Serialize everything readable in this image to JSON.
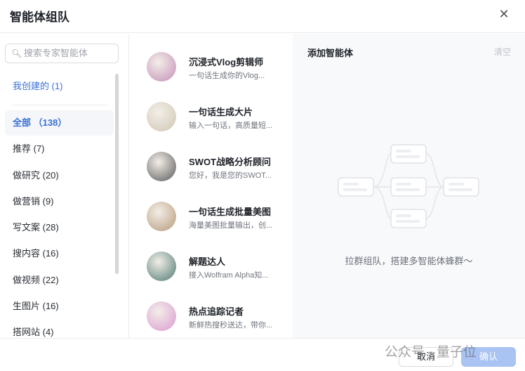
{
  "header": {
    "title": "智能体组队"
  },
  "sidebar": {
    "search_placeholder": "搜索专家智能体",
    "my_created": "我创建的 (1)",
    "categories": [
      {
        "label": "全部 （138）"
      },
      {
        "label": "推荐 (7)"
      },
      {
        "label": "做研究 (20)"
      },
      {
        "label": "做营销 (9)"
      },
      {
        "label": "写文案 (28)"
      },
      {
        "label": "搜内容 (16)"
      },
      {
        "label": "做视频 (22)"
      },
      {
        "label": "生图片 (16)"
      },
      {
        "label": "搭网站 (4)"
      }
    ]
  },
  "agents": [
    {
      "name": "沉浸式Vlog剪辑师",
      "desc": "一句话生成你的Vlog...",
      "color": "#c58fb8"
    },
    {
      "name": "一句话生成大片",
      "desc": "输入一句话，高质量短...",
      "color": "#cfc6b3"
    },
    {
      "name": "SWOT战略分析顾问",
      "desc": "您好，我是您的SWOT...",
      "color": "#5a5a5a"
    },
    {
      "name": "一句话生成批量美图",
      "desc": "海量美图批量输出，创...",
      "color": "#b79a7a"
    },
    {
      "name": "解题达人",
      "desc": "接入Wolfram Alpha知...",
      "color": "#4d7a72"
    },
    {
      "name": "热点追踪记者",
      "desc": "新鲜热搜秒送达，带你...",
      "color": "#d99ad0"
    }
  ],
  "right": {
    "title": "添加智能体",
    "clear": "清空",
    "empty_text": "拉群组队，搭建多智能体蜂群～"
  },
  "footer": {
    "cancel": "取消",
    "confirm": "确认",
    "watermark": "公众号 · 量子位"
  }
}
